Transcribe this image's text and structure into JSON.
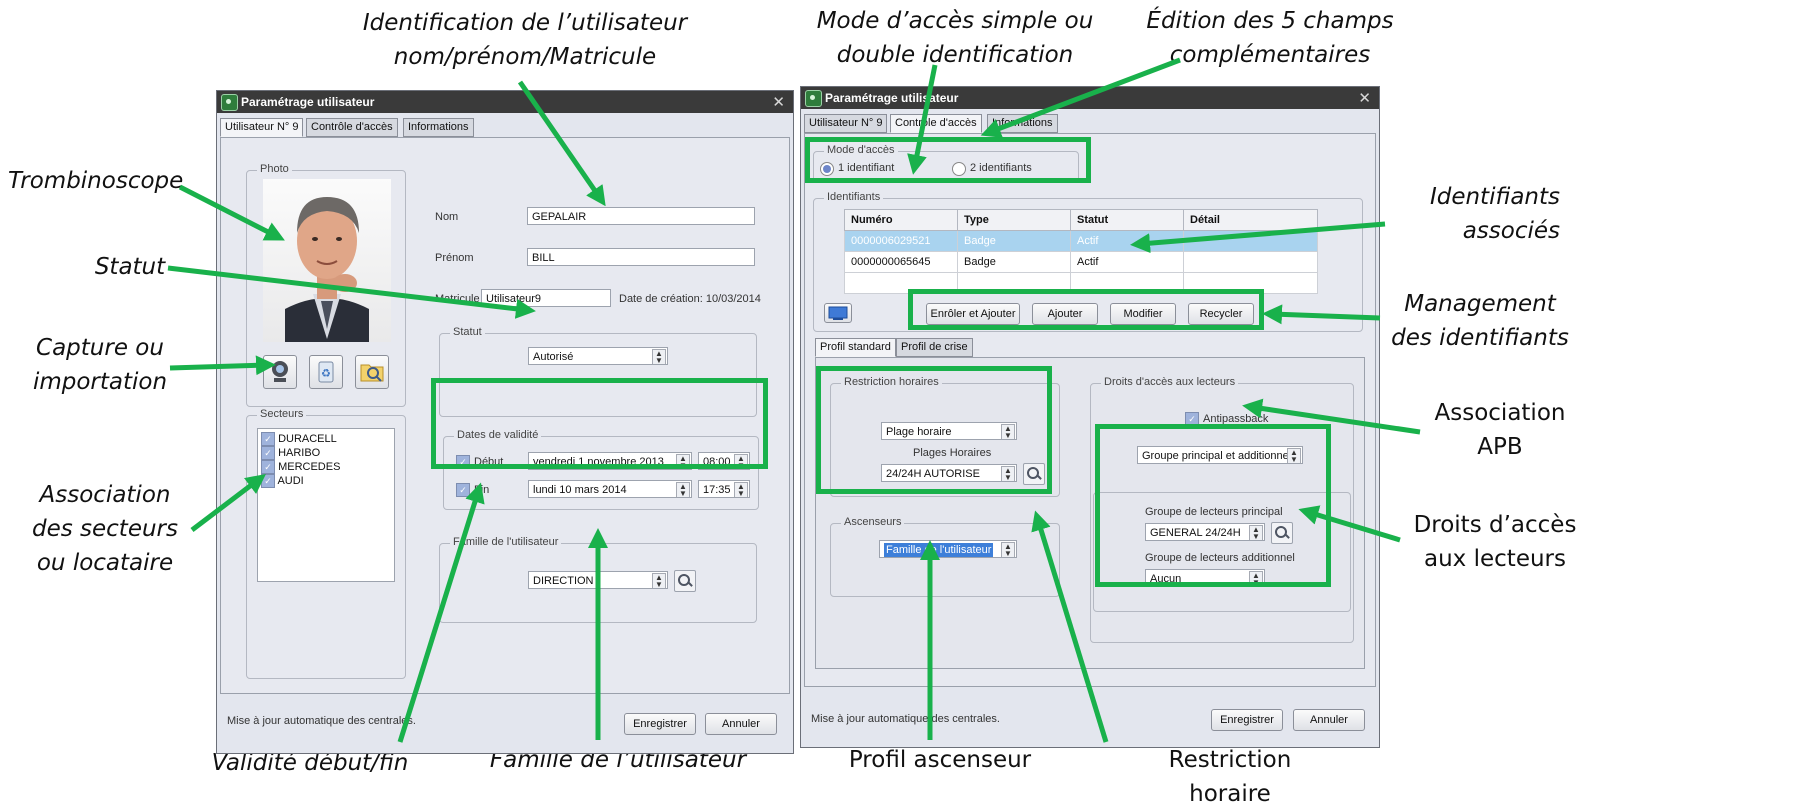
{
  "callouts": {
    "identification": "Identification de l’utilisateur\nnom/prénom/Matricule",
    "trombinoscope": "Trombinoscope",
    "statut": "Statut",
    "capture": "Capture ou\nimportation",
    "secteurs": "Association\ndes secteurs\nou locataire",
    "validite": "Validité début/fin",
    "famille": "Famille de l’utilisateur",
    "mode_acces": "Mode d’accès simple ou\ndouble identification",
    "edition": "Édition des 5 champs\ncomplémentaires",
    "identifiants": "Identifiants\nassociés",
    "management": "Management\ndes identifiants",
    "apb": "Association\nAPB",
    "droits": "Droits d’accès\naux lecteurs",
    "ascenseur": "Profil ascenseur",
    "restriction": "Restriction horaire"
  },
  "left": {
    "title": "Paramétrage utilisateur",
    "tabs": [
      "Utilisateur N° 9",
      "Contrôle d'accès",
      "Informations"
    ],
    "photo_group": "Photo",
    "nom_label": "Nom",
    "nom_value": "GEPALAIR",
    "prenom_label": "Prénom",
    "prenom_value": "BILL",
    "matricule_label": "Matricule",
    "matricule_value": "Utilisateur9",
    "date_creation": "Date de création:  10/03/2014",
    "statut_group": "Statut",
    "statut_value": "Autorisé",
    "dates_group": "Dates de validité",
    "debut_label": "Début",
    "debut_date": "vendredi   1 novembre 2013",
    "debut_time": "08:00",
    "fin_label": "Fin",
    "fin_date": "lundi    10    mars    2014",
    "fin_time": "17:35",
    "secteurs_group": "Secteurs",
    "secteurs": [
      "DURACELL",
      "HARIBO",
      "MERCEDES",
      "AUDI"
    ],
    "famille_group": "Famille de l'utilisateur",
    "famille_value": "DIRECTION",
    "status_text": "Mise à jour automatique des centrales.",
    "save": "Enregistrer",
    "cancel": "Annuler"
  },
  "right": {
    "title": "Paramétrage utilisateur",
    "tabs": [
      "Utilisateur N° 9",
      "Contrôle d'accès",
      "Informations"
    ],
    "mode_group": "Mode d'accès",
    "mode_options": [
      "1 identifiant",
      "2 identifiants"
    ],
    "ident_group": "Identifiants",
    "columns": [
      "Numéro",
      "Type",
      "Statut",
      "Détail"
    ],
    "rows": [
      [
        "0000006029521",
        "Badge",
        "Actif",
        ""
      ],
      [
        "0000000065645",
        "Badge",
        "Actif",
        ""
      ]
    ],
    "buttons": [
      "Enrôler et Ajouter",
      "Ajouter",
      "Modifier",
      "Recycler"
    ],
    "profile_tabs": [
      "Profil standard",
      "Profil de crise"
    ],
    "restriction_group": "Restriction horaires",
    "plage_value": "Plage horaire",
    "plages_label": "Plages Horaires",
    "plages_value": "24/24H AUTORISE",
    "ascenseurs_group": "Ascenseurs",
    "ascenseurs_value": "Famille de l'utilisateur",
    "droits_group": "Droits d'accès aux lecteurs",
    "antipassback": "Antipassback",
    "groupe_value": "Groupe principal et additionnel",
    "principal_label": "Groupe de lecteurs principal",
    "principal_value": "GENERAL 24/24H",
    "additionnel_label": "Groupe de lecteurs additionnel",
    "additionnel_value": "Aucun",
    "status_text": "Mise à jour automatique des centrales.",
    "save": "Enregistrer",
    "cancel": "Annuler"
  },
  "colors": {
    "highlight": "#19b14b",
    "titlebar": "#3a3a3a",
    "selected_row": "#a9d3ef"
  }
}
